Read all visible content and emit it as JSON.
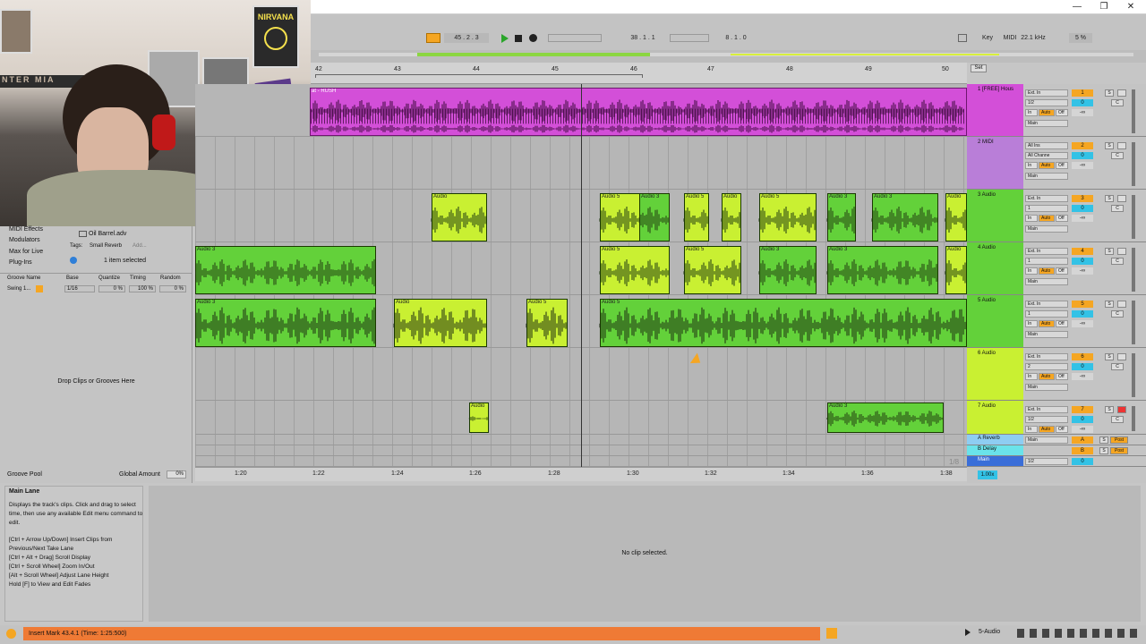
{
  "window": {
    "minimize": "—",
    "restore": "❐",
    "close": "✕"
  },
  "control_bar": {
    "position": "45 .  2 .  3",
    "loop_start": "38 .  1 .  1",
    "loop_length": "8 .  1 .  0",
    "key_label": "Key",
    "midi_label": "MIDI",
    "sample_rate": "22.1 kHz",
    "cpu": "5 %"
  },
  "webcam": {
    "poster_text": "NIRVANA",
    "banner_text": "NTER MIA"
  },
  "ruler": {
    "bars": [
      "42",
      "43",
      "44",
      "45",
      "46",
      "47",
      "48",
      "49",
      "50"
    ],
    "set_label": "Set"
  },
  "browser": {
    "items": [
      "MIDI Effects",
      "Modulators",
      "Max for Live",
      "Plug-Ins"
    ],
    "file": "Oil Barrel.adv",
    "tags_label": "Tags:",
    "tags_value": "Small Reverb",
    "tags_add": "Add...",
    "selected": "1 item selected",
    "groove_headers": [
      "Groove Name",
      "Base",
      "Quantize",
      "Timing",
      "Random"
    ],
    "groove_row": {
      "name": "Swing 1...",
      "base": "1/16",
      "quantize": "0 %",
      "timing": "100 %",
      "random": "0 %"
    },
    "drop_text": "Drop Clips or Grooves Here",
    "groove_pool": "Groove Pool",
    "global_amount_label": "Global Amount",
    "global_amount_value": "0%"
  },
  "arrangement": {
    "track1_clip": "at - RUSH",
    "audio3": "Audio 3",
    "audio5": "Audio 5",
    "audio": "Audio",
    "a": "A"
  },
  "tracks": [
    {
      "name": "1 [FREE] Hous",
      "num": "1",
      "input": "Ext. In",
      "chan": "1/2",
      "out": "Main",
      "vol": "0",
      "pan": "C",
      "db": "-∞"
    },
    {
      "name": "2 MIDI",
      "num": "2",
      "input": "All Ins",
      "chan": "All Channe",
      "out": "Main",
      "vol": "0",
      "pan": "C",
      "db": "-∞"
    },
    {
      "name": "3 Audio",
      "num": "3",
      "input": "Ext. In",
      "chan": "1",
      "out": "Main",
      "vol": "0",
      "pan": "C",
      "db": "-∞"
    },
    {
      "name": "4 Audio",
      "num": "4",
      "input": "Ext. In",
      "chan": "1",
      "out": "Main",
      "vol": "0",
      "pan": "C",
      "db": "-∞"
    },
    {
      "name": "5 Audio",
      "num": "5",
      "input": "Ext. In",
      "chan": "1",
      "out": "Main",
      "vol": "0",
      "pan": "C",
      "db": "-∞"
    },
    {
      "name": "6 Audio",
      "num": "6",
      "input": "Ext. In",
      "chan": "2",
      "out": "Main",
      "vol": "0",
      "pan": "C",
      "db": "-∞"
    },
    {
      "name": "7 Audio",
      "num": "7",
      "input": "Ext. In",
      "chan": "1/2",
      "out": "Main",
      "vol": "0",
      "pan": "C",
      "db": "-∞"
    }
  ],
  "returns": [
    {
      "name": "A Reverb",
      "letter": "A",
      "post": "Post",
      "vol": "0",
      "pan": "C"
    },
    {
      "name": "B Delay",
      "letter": "B",
      "post": "Post",
      "vol": "0",
      "pan": "C"
    },
    {
      "name": "Main",
      "chan": "1/2",
      "vol": "0"
    }
  ],
  "labels": {
    "in": "In",
    "auto": "Auto",
    "off": "Off",
    "s": "S",
    "zoom": "1.00x",
    "h": "H",
    "w": "W",
    "fraction": "1/8"
  },
  "time_ruler": [
    "1:20",
    "1:22",
    "1:24",
    "1:26",
    "1:28",
    "1:30",
    "1:32",
    "1:34",
    "1:36",
    "1:38"
  ],
  "info": {
    "title": "Main Lane",
    "body": "Displays the track's clips. Click and drag to select time, then use any available Edit menu command to edit.",
    "shortcuts": [
      "[Ctrl + Arrow Up/Down] Insert Clips from Previous/Next Take Lane",
      "[Ctrl + Alt + Drag] Scroll Display",
      "[Ctrl + Scroll Wheel] Zoom In/Out",
      "[Alt + Scroll Wheel] Adjust Lane Height",
      "Hold [F] to View and Edit Fades"
    ]
  },
  "detail": {
    "no_clip": "No clip selected."
  },
  "status": {
    "message": "Insert Mark 43.4.1 (Time: 1:25:500)",
    "track": "5-Audio"
  }
}
